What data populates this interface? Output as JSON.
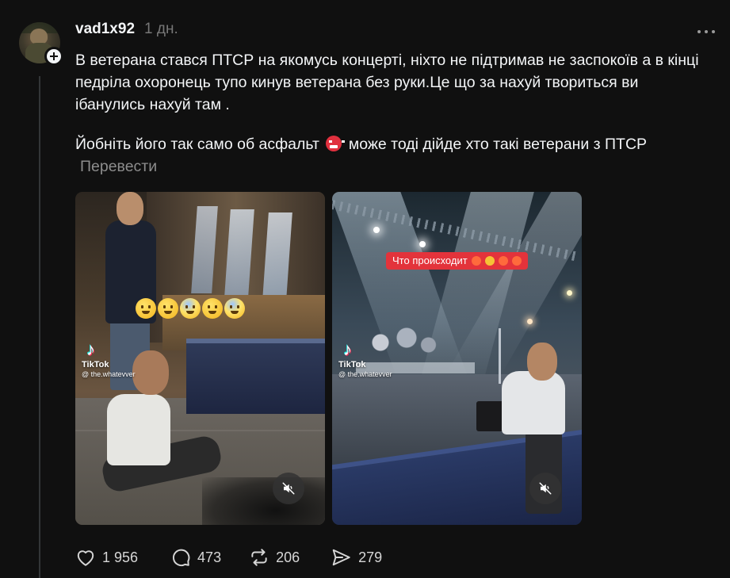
{
  "post": {
    "username": "vad1x92",
    "time": "1 дн.",
    "paragraph1": "В ветерана стався ПТСР на якомусь концерті, ніхто не підтримав не заспокоїв а в кінці педріла охоронець тупо кинув ветерана без руки.Це що за нахуй твориться ви ібанулись нахуй там .",
    "paragraph2_part1": "Йобніть його так само об асфальт",
    "paragraph2_part2": "може тоді дійде хто такі ветерани з ПТСР",
    "translate_label": "Перевести"
  },
  "media": [
    {
      "tiktok_brand": "TikTok",
      "tiktok_handle": "@ the.whatevver",
      "icons": [
        "exploding-head-icon",
        "woozy-face-icon",
        "anxious-face-icon",
        "grimacing-face-icon",
        "screaming-face-icon"
      ]
    },
    {
      "tiktok_brand": "TikTok",
      "tiktok_handle": "@ the.whatevver",
      "caption": "Что происходит"
    }
  ],
  "actions": {
    "likes": "1 956",
    "comments": "473",
    "reposts": "206",
    "shares": "279"
  },
  "colors": {
    "background": "#101010",
    "text": "#f3f5f7",
    "muted": "#777777",
    "caption_bg": "#e3333b"
  }
}
